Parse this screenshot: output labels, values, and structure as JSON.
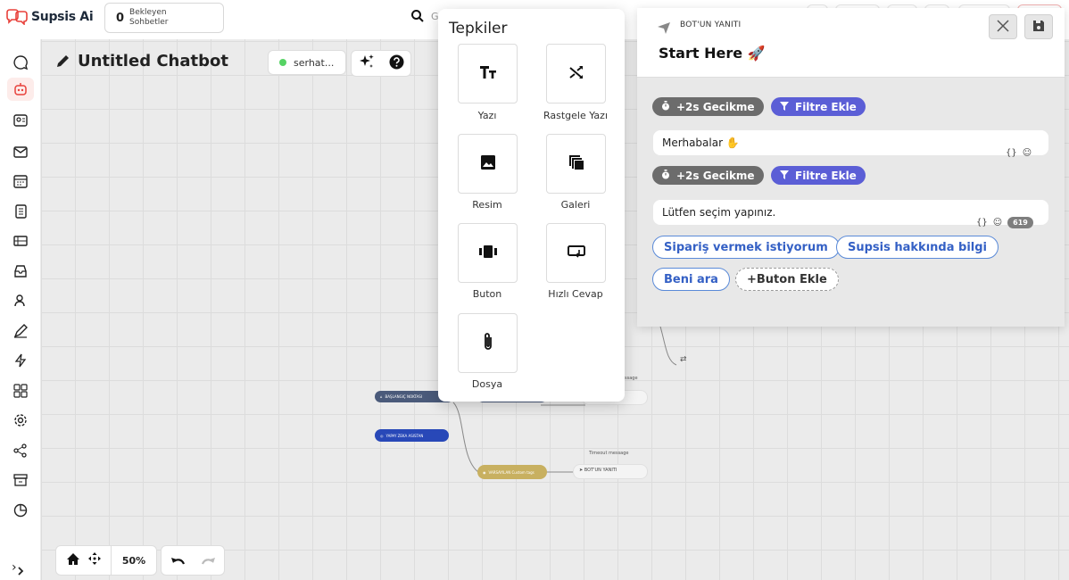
{
  "app": {
    "name": "Supsis Ai"
  },
  "pending": {
    "count": "0",
    "label": "Bekleyen\nSohbetler"
  },
  "search": {
    "placeholder": "G"
  },
  "chatbot": {
    "title": "Untitled Chatbot",
    "user": "serhat..."
  },
  "canvas_nodes": {
    "start": "BAŞLANGIÇ NOKTASI",
    "ai": "YAPAY ZEKA ASISTAN",
    "vars": "VARSAYILAN Custom tags",
    "timeout_label": "Timeout message",
    "message_label": "ssage",
    "bot_reply": "BOT'UN YANITI"
  },
  "zoom": {
    "value": "50%"
  },
  "reactions": {
    "title": "Tepkiler",
    "items": [
      {
        "label": "Yazı",
        "icon": "text-icon"
      },
      {
        "label": "Rastgele Yazı",
        "icon": "shuffle-icon"
      },
      {
        "label": "Resim",
        "icon": "image-icon"
      },
      {
        "label": "Galeri",
        "icon": "gallery-icon"
      },
      {
        "label": "Buton",
        "icon": "button-icon"
      },
      {
        "label": "Hızlı Cevap",
        "icon": "quick-reply-icon"
      },
      {
        "label": "Dosya",
        "icon": "paperclip-icon"
      }
    ]
  },
  "panel": {
    "kind": "BOT'UN YANITI",
    "title": "Start Here 🚀",
    "delay_label": "+2s Gecikme",
    "filter_label": "Filtre Ekle",
    "message1": "Merhabalar ✋",
    "message2": "Lütfen seçim yapınız.",
    "char_count": "619",
    "buttons": [
      "Sipariş vermek istiyorum",
      "Supsis hakkında bilgi",
      "Beni ara"
    ],
    "add_button": "+Buton Ekle",
    "var_glyph": "{}",
    "emoji_glyph": "☺"
  },
  "colors": {
    "brand": "#e8403a",
    "accent": "#5b5ed6",
    "chip_gray": "#6c6c6c",
    "qbtn": "#3460c5"
  }
}
